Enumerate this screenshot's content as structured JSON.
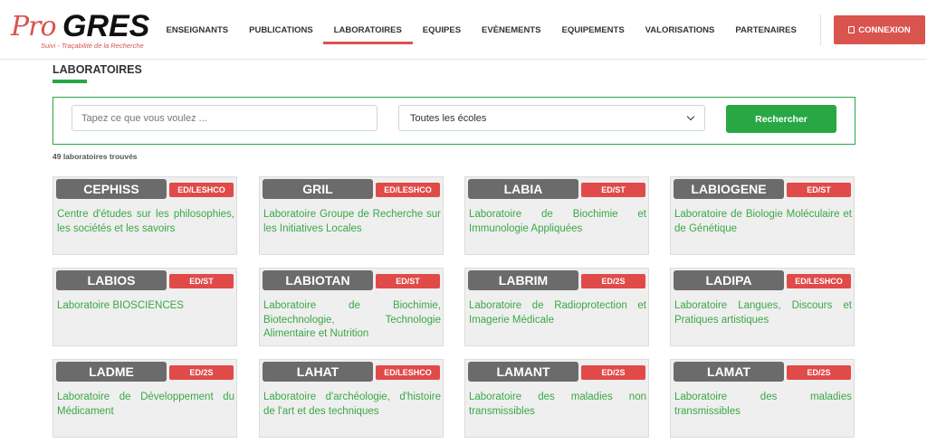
{
  "header": {
    "logo": {
      "pro": "Pro",
      "gres": "GRES",
      "tagline": "Suivi - Traçabilité de la Recherche"
    },
    "nav": [
      {
        "label": "ENSEIGNANTS",
        "active": false
      },
      {
        "label": "PUBLICATIONS",
        "active": false
      },
      {
        "label": "LABORATOIRES",
        "active": true
      },
      {
        "label": "EQUIPES",
        "active": false
      },
      {
        "label": "EVÈNEMENTS",
        "active": false
      },
      {
        "label": "EQUIPEMENTS",
        "active": false
      },
      {
        "label": "VALORISATIONS",
        "active": false
      },
      {
        "label": "PARTENAIRES",
        "active": false
      }
    ],
    "login_label": "CONNEXION",
    "login_icon": "login-icon"
  },
  "page": {
    "title": "LABORATOIRES",
    "search_placeholder": "Tapez ce que vous voulez ...",
    "select_value": "Toutes les écoles",
    "search_button": "Rechercher",
    "result_count": "49 laboratoires trouvés"
  },
  "labs": [
    {
      "acronym": "CEPHISS",
      "school": "ED/LESHCO",
      "name": "Centre d'études sur les philosophies, les sociétés et les savoirs"
    },
    {
      "acronym": "GRIL",
      "school": "ED/LESHCO",
      "name": "Laboratoire Groupe de Recherche sur les Initiatives Locales"
    },
    {
      "acronym": "LABIA",
      "school": "ED/ST",
      "name": "Laboratoire de Biochimie et Immunologie Appliquées"
    },
    {
      "acronym": "LABIOGENE",
      "school": "ED/ST",
      "name": "Laboratoire de Biologie Moléculaire et de Génétique"
    },
    {
      "acronym": "LABIOS",
      "school": "ED/ST",
      "name": "Laboratoire BIOSCIENCES"
    },
    {
      "acronym": "LABIOTAN",
      "school": "ED/ST",
      "name": "Laboratoire de Biochimie, Biotechnologie, Technologie Alimentaire et Nutrition"
    },
    {
      "acronym": "LABRIM",
      "school": "ED/2S",
      "name": "Laboratoire de Radioprotection et Imagerie Médicale"
    },
    {
      "acronym": "LADIPA",
      "school": "ED/LESHCO",
      "name": "Laboratoire Langues, Discours et Pratiques artistiques"
    },
    {
      "acronym": "LADME",
      "school": "ED/2S",
      "name": "Laboratoire de Développement du Médicament"
    },
    {
      "acronym": "LAHAT",
      "school": "ED/LESHCO",
      "name": "Laboratoire d'archéologie, d'histoire de l'art et des techniques"
    },
    {
      "acronym": "LAMANT",
      "school": "ED/2S",
      "name": "Laboratoire des maladies non transmissibles"
    },
    {
      "acronym": "LAMAT",
      "school": "ED/2S",
      "name": "Laboratoire des maladies transmissibles"
    }
  ],
  "colors": {
    "accent_red": "#d9534f",
    "accent_green": "#28a745",
    "acronym_bg": "#6b6b6b"
  }
}
